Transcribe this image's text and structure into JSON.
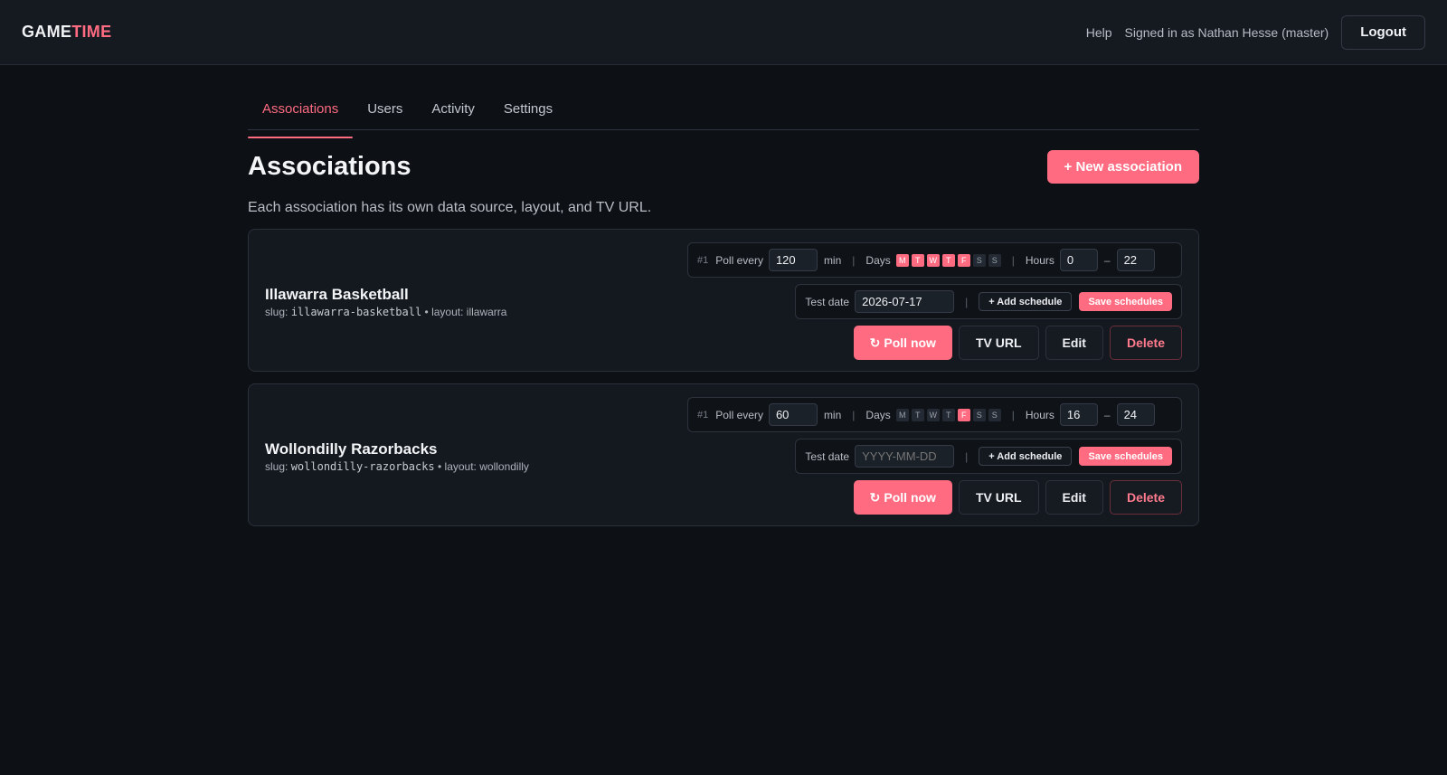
{
  "header": {
    "logo_part1": "GAME",
    "logo_part2": "TIME",
    "help": "Help",
    "signed_in": "Signed in as Nathan Hesse (master)",
    "logout": "Logout"
  },
  "tabs": [
    {
      "label": "Associations",
      "active": true
    },
    {
      "label": "Users",
      "active": false
    },
    {
      "label": "Activity",
      "active": false
    },
    {
      "label": "Settings",
      "active": false
    }
  ],
  "page": {
    "title": "Associations",
    "new_button": "+ New association",
    "subtitle": "Each association has its own data source, layout, and TV URL."
  },
  "labels": {
    "poll_every": "Poll every",
    "min": "min",
    "days": "Days",
    "hours": "Hours",
    "test_date": "Test date",
    "add_schedule": "+ Add schedule",
    "save_schedules": "Save schedules",
    "poll_now": "Poll now",
    "tv_url": "TV URL",
    "edit": "Edit",
    "delete": "Delete",
    "sep": "|",
    "dash": "–",
    "slug_prefix": "slug:",
    "layout_prefix": "• layout:"
  },
  "associations": [
    {
      "name": "Illawarra Basketball",
      "slug": "illawarra-basketball",
      "layout": "illawarra",
      "schedule_num": "#1",
      "poll_every": "120",
      "days": [
        {
          "letter": "M",
          "on": true
        },
        {
          "letter": "T",
          "on": true
        },
        {
          "letter": "W",
          "on": true
        },
        {
          "letter": "T",
          "on": true
        },
        {
          "letter": "F",
          "on": true
        },
        {
          "letter": "S",
          "on": false
        },
        {
          "letter": "S",
          "on": false
        }
      ],
      "hours_from": "0",
      "hours_to": "22",
      "test_date": "2026-07-17",
      "test_date_placeholder": ""
    },
    {
      "name": "Wollondilly Razorbacks",
      "slug": "wollondilly-razorbacks",
      "layout": "wollondilly",
      "schedule_num": "#1",
      "poll_every": "60",
      "days": [
        {
          "letter": "M",
          "on": false
        },
        {
          "letter": "T",
          "on": false
        },
        {
          "letter": "W",
          "on": false
        },
        {
          "letter": "T",
          "on": false
        },
        {
          "letter": "F",
          "on": true
        },
        {
          "letter": "S",
          "on": false
        },
        {
          "letter": "S",
          "on": false
        }
      ],
      "hours_from": "16",
      "hours_to": "24",
      "test_date": "",
      "test_date_placeholder": "YYYY-MM-DD"
    }
  ],
  "colors": {
    "accent": "#ff6b81",
    "background": "#0d1015",
    "card": "#141920"
  },
  "icons": {
    "poll": "refresh-icon"
  }
}
